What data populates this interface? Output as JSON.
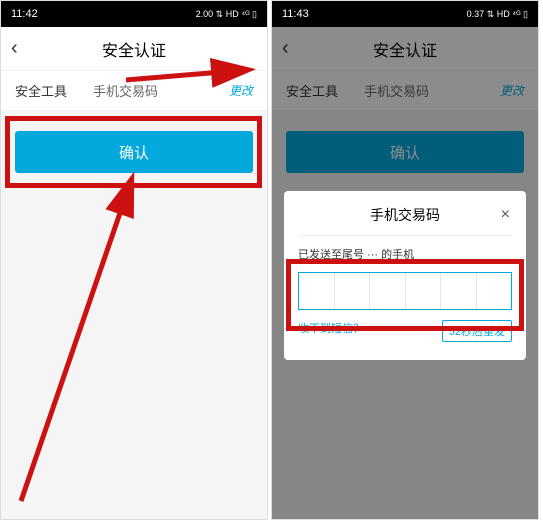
{
  "left": {
    "status": {
      "time": "11:42",
      "indicators": "2.00 ⇅ HD ⁴ᴳ ▯"
    },
    "nav": {
      "title": "安全认证",
      "back": "‹"
    },
    "row": {
      "label": "安全工具",
      "value": "手机交易码",
      "change": "更改"
    },
    "confirm": "确认"
  },
  "right": {
    "status": {
      "time": "11:43",
      "indicators": "0.37 ⇅ HD ⁴ᴳ ▯"
    },
    "nav": {
      "title": "安全认证",
      "back": "‹"
    },
    "row": {
      "label": "安全工具",
      "value": "手机交易码",
      "change": "更改"
    },
    "confirm": "确认",
    "modal": {
      "title": "手机交易码",
      "close": "×",
      "sent_text": "已发送至尾号 ··· 的手机",
      "no_sms": "收不到短信？",
      "resend": "52秒后重发"
    }
  }
}
